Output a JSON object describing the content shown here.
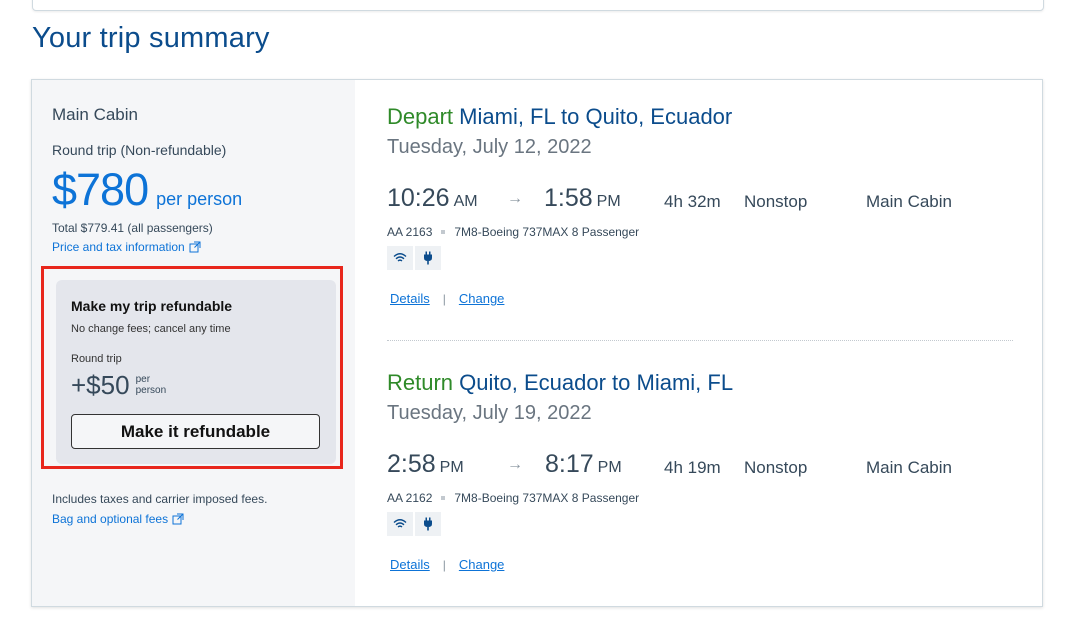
{
  "page": {
    "title": "Your trip summary"
  },
  "fare": {
    "cabin": "Main Cabin",
    "trip_type": "Round trip (Non-refundable)",
    "price": "$780",
    "price_unit": "per person",
    "total": "Total $779.41 (all passengers)",
    "tax_link": "Price and tax information",
    "fees_note": "Includes taxes and carrier imposed fees.",
    "bag_link": "Bag and optional fees"
  },
  "refund": {
    "title": "Make my trip refundable",
    "subtitle": "No change fees; cancel any time",
    "trip_label": "Round trip",
    "price": "+$50",
    "price_unit": "per person",
    "button_label": "Make it refundable"
  },
  "segments": [
    {
      "direction": "Depart",
      "route": "Miami, FL to Quito, Ecuador",
      "date": "Tuesday, July 12, 2022",
      "depart_time": "10:26",
      "depart_ampm": "AM",
      "arrive_time": "1:58",
      "arrive_ampm": "PM",
      "duration": "4h 32m",
      "stops": "Nonstop",
      "cabin": "Main Cabin",
      "flight_number": "AA 2163",
      "aircraft": "7M8-Boeing 737MAX 8 Passenger",
      "amenities": [
        "wifi-icon",
        "power-icon"
      ],
      "details_label": "Details",
      "change_label": "Change"
    },
    {
      "direction": "Return",
      "route": "Quito, Ecuador to Miami, FL",
      "date": "Tuesday, July 19, 2022",
      "depart_time": "2:58",
      "depart_ampm": "PM",
      "arrive_time": "8:17",
      "arrive_ampm": "PM",
      "duration": "4h 19m",
      "stops": "Nonstop",
      "cabin": "Main Cabin",
      "flight_number": "AA 2162",
      "aircraft": "7M8-Boeing 737MAX 8 Passenger",
      "amenities": [
        "wifi-icon",
        "power-icon"
      ],
      "details_label": "Details",
      "change_label": "Change"
    }
  ],
  "colors": {
    "brand_blue": "#0b4c8c",
    "link_blue": "#0d73d7",
    "direction_green": "#2f8a29",
    "highlight_red": "#e8261c"
  }
}
